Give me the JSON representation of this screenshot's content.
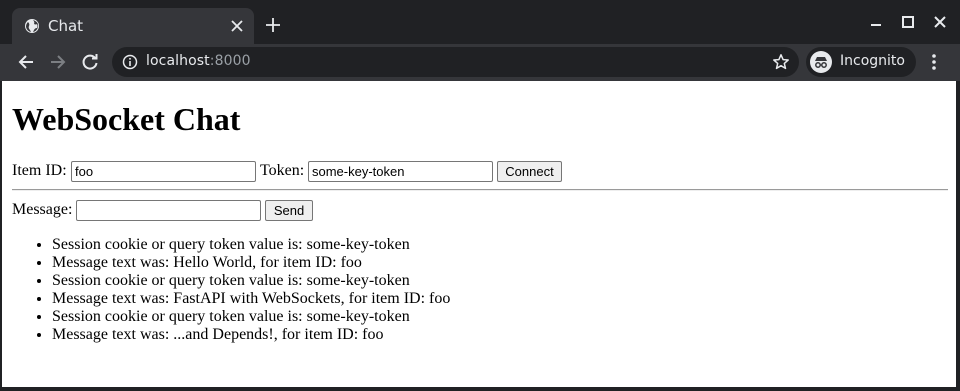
{
  "browser": {
    "tab_title": "Chat",
    "url_host": "localhost",
    "url_port": ":8000",
    "profile_label": "Incognito"
  },
  "page": {
    "title": "WebSocket Chat",
    "item_id_label": "Item ID:",
    "item_id_value": "foo",
    "token_label": "Token:",
    "token_value": "some-key-token",
    "connect_label": "Connect",
    "message_label": "Message:",
    "message_value": "",
    "send_label": "Send",
    "messages": [
      "Session cookie or query token value is: some-key-token",
      "Message text was: Hello World, for item ID: foo",
      "Session cookie or query token value is: some-key-token",
      "Message text was: FastAPI with WebSockets, for item ID: foo",
      "Session cookie or query token value is: some-key-token",
      "Message text was: ...and Depends!, for item ID: foo"
    ]
  }
}
